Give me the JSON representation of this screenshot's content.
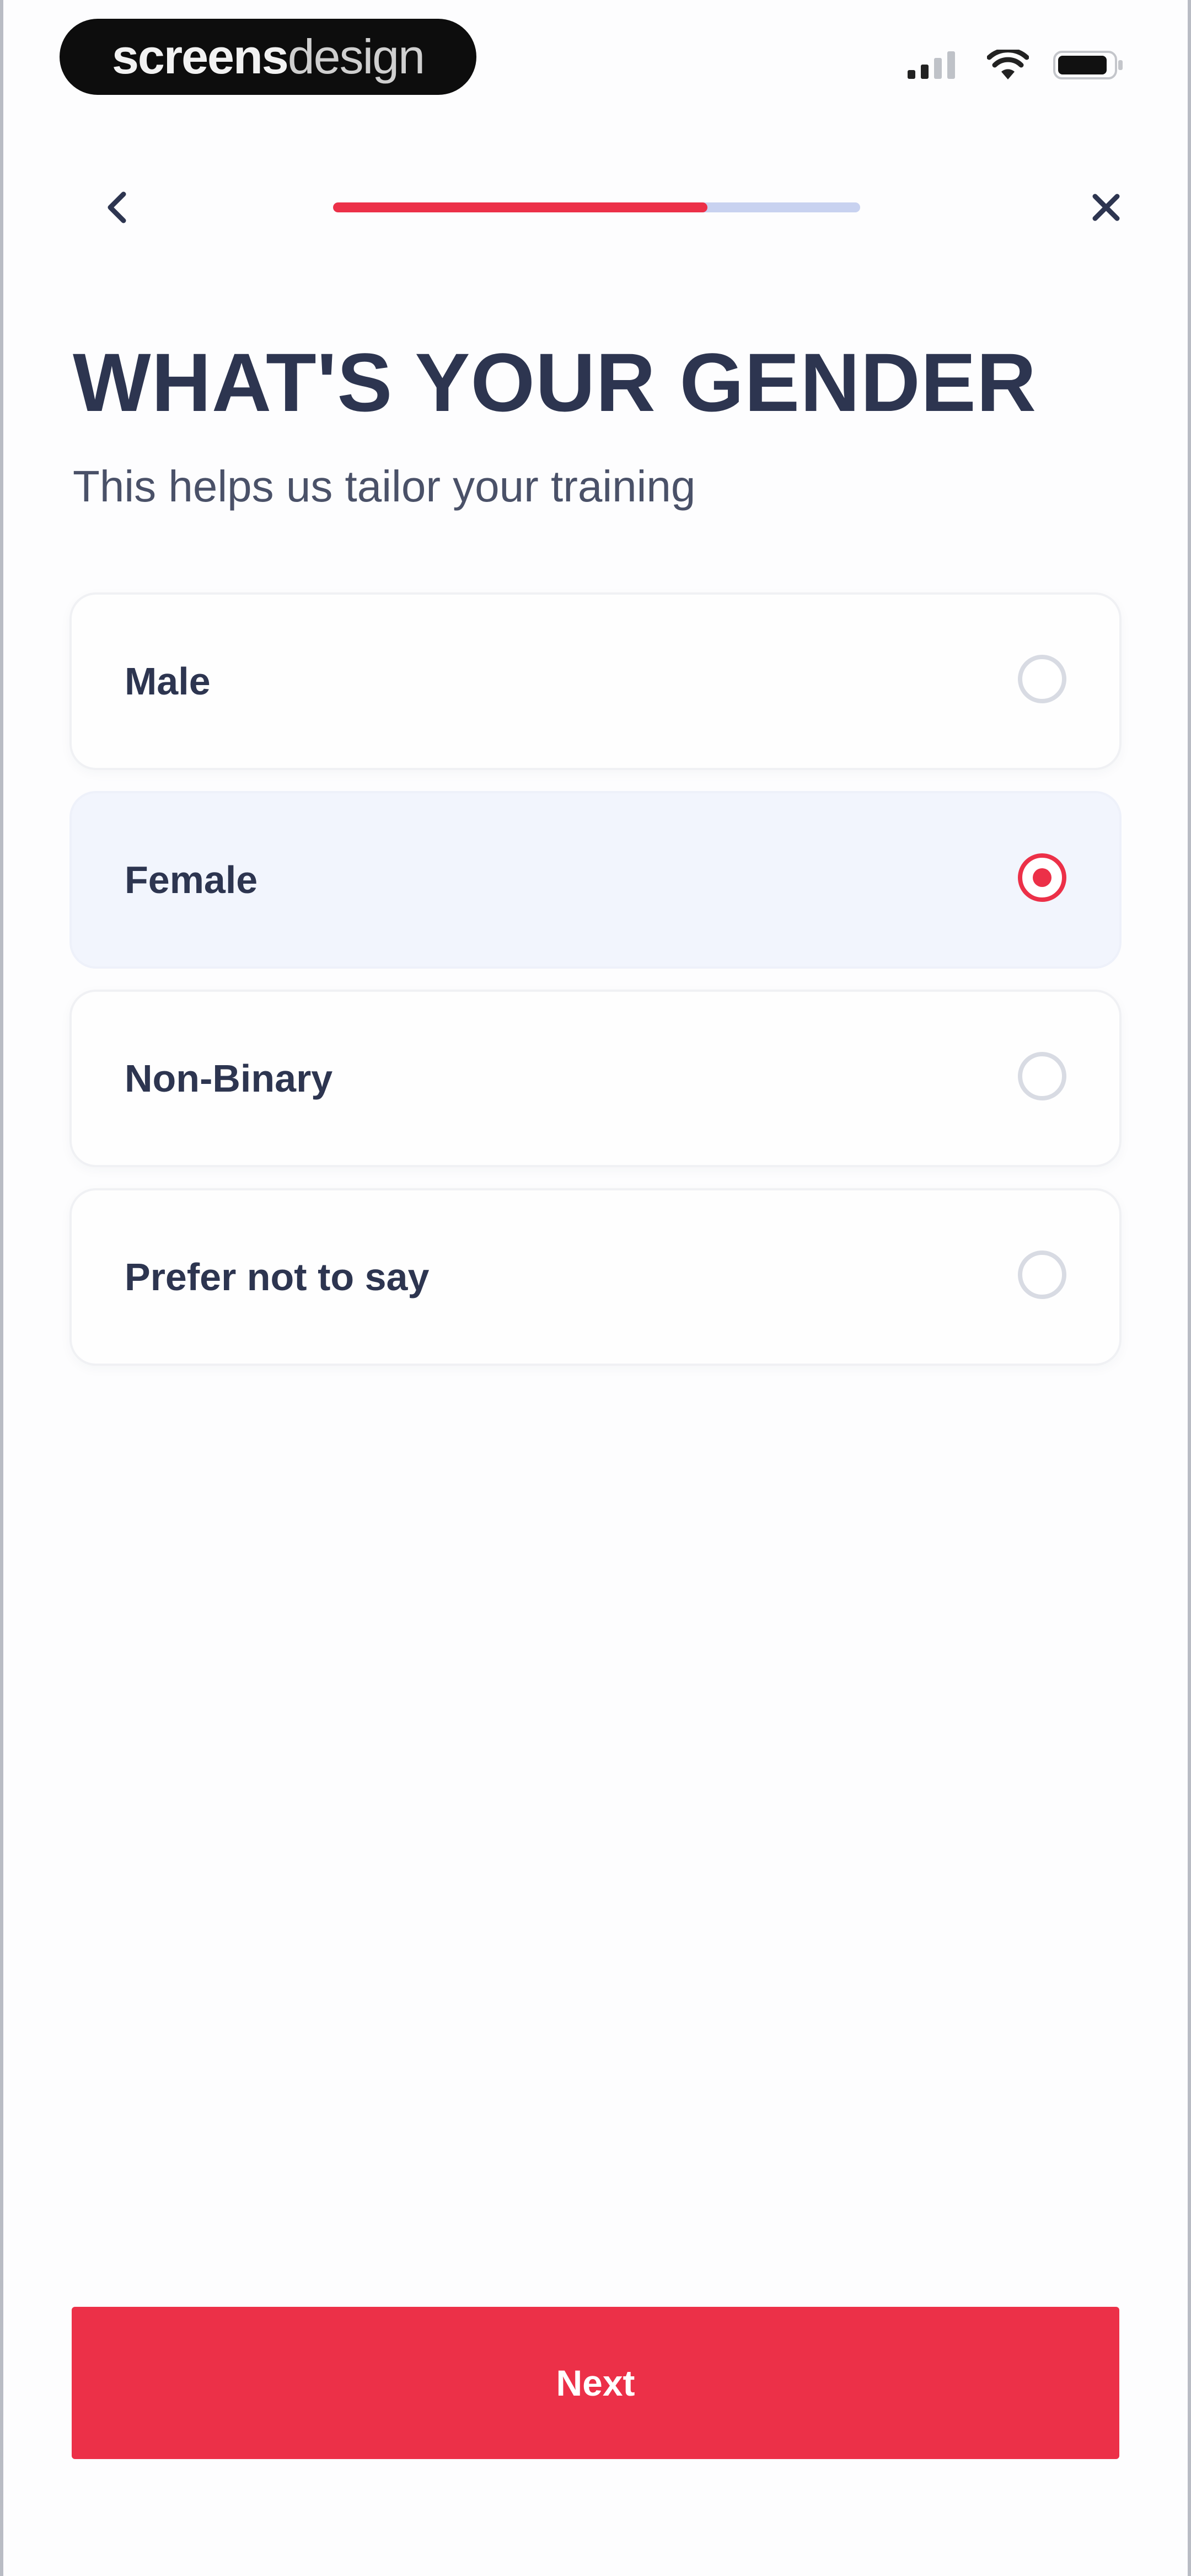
{
  "status_bar": {
    "brand_bold": "screens",
    "brand_light": "design",
    "signal_icon": "signal-icon",
    "wifi_icon": "wifi-icon",
    "battery_icon": "battery-icon"
  },
  "nav": {
    "back_icon": "chevron-left-icon",
    "close_icon": "close-icon",
    "progress_fraction": 0.71
  },
  "header": {
    "title": "WHAT'S YOUR GENDER",
    "subtitle": "This helps us tailor your training"
  },
  "options": [
    {
      "label": "Male",
      "selected": false
    },
    {
      "label": "Female",
      "selected": true
    },
    {
      "label": "Non-Binary",
      "selected": false
    },
    {
      "label": "Prefer not to say",
      "selected": false
    }
  ],
  "footer": {
    "next_label": "Next"
  },
  "colors": {
    "accent": "#ec3048",
    "text": "#2d3550",
    "selected_bg": "#f2f5fd",
    "progress_track": "#c8d2f0"
  }
}
